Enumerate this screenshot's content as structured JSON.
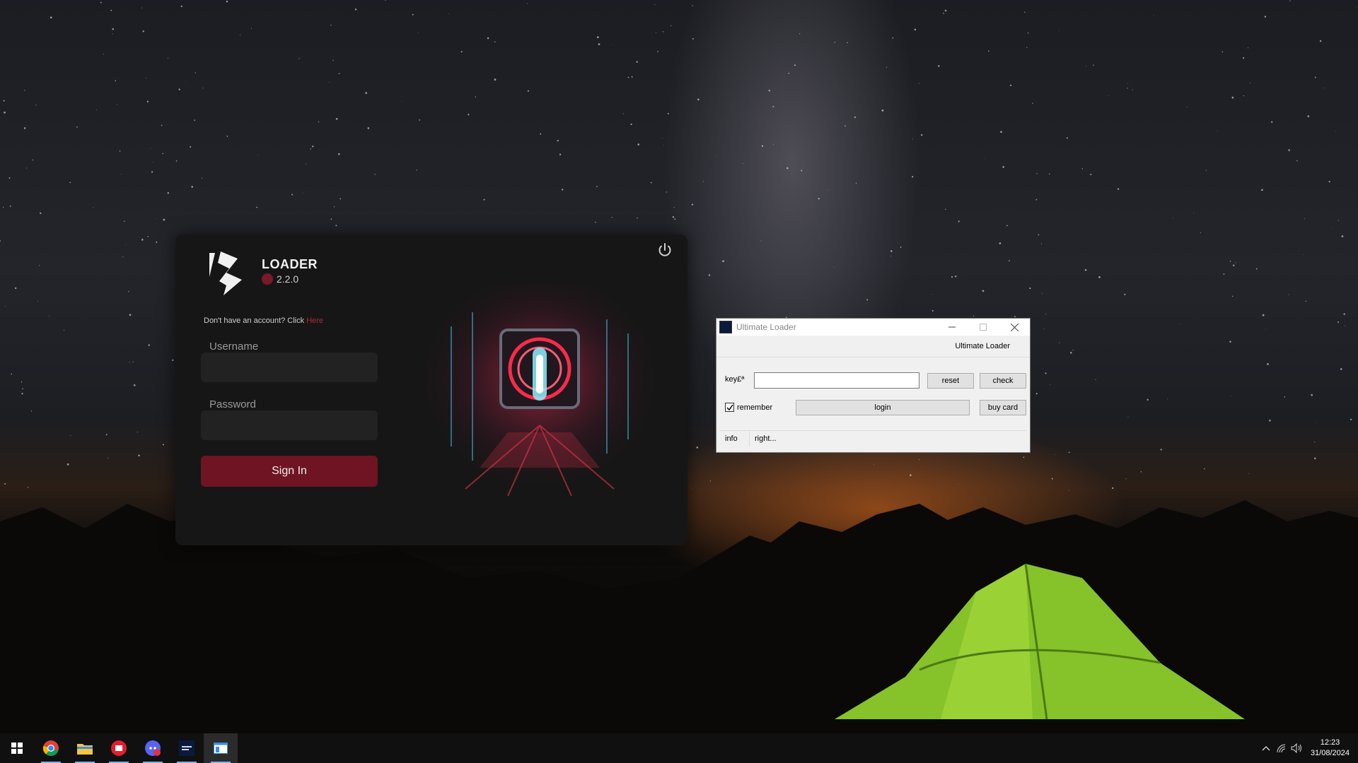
{
  "loader": {
    "title": "LOADER",
    "version": "2.2.0",
    "account_prompt": "Don't have an account? Click",
    "account_link": "Here",
    "username_label": "Username",
    "password_label": "Password",
    "username_value": "",
    "password_value": "",
    "signin_label": "Sign In",
    "accent_color": "#6e1422"
  },
  "ultimate_loader": {
    "window_title": "Ultimate Loader",
    "header_label": "Ultimate Loader",
    "key_label": "key£ª",
    "key_value": "",
    "reset_label": "reset",
    "check_label": "check",
    "remember_label": "remember",
    "remember_checked": true,
    "login_label": "login",
    "buy_card_label": "buy card",
    "status_info": "info",
    "status_right": "right..."
  },
  "taskbar": {
    "apps": [
      "windows-start-icon",
      "chrome-icon",
      "file-explorer-icon",
      "red-app-icon",
      "discord-icon",
      "loader-app-icon",
      "active-window-icon"
    ],
    "time": "12:23",
    "date": "31/08/2024"
  }
}
